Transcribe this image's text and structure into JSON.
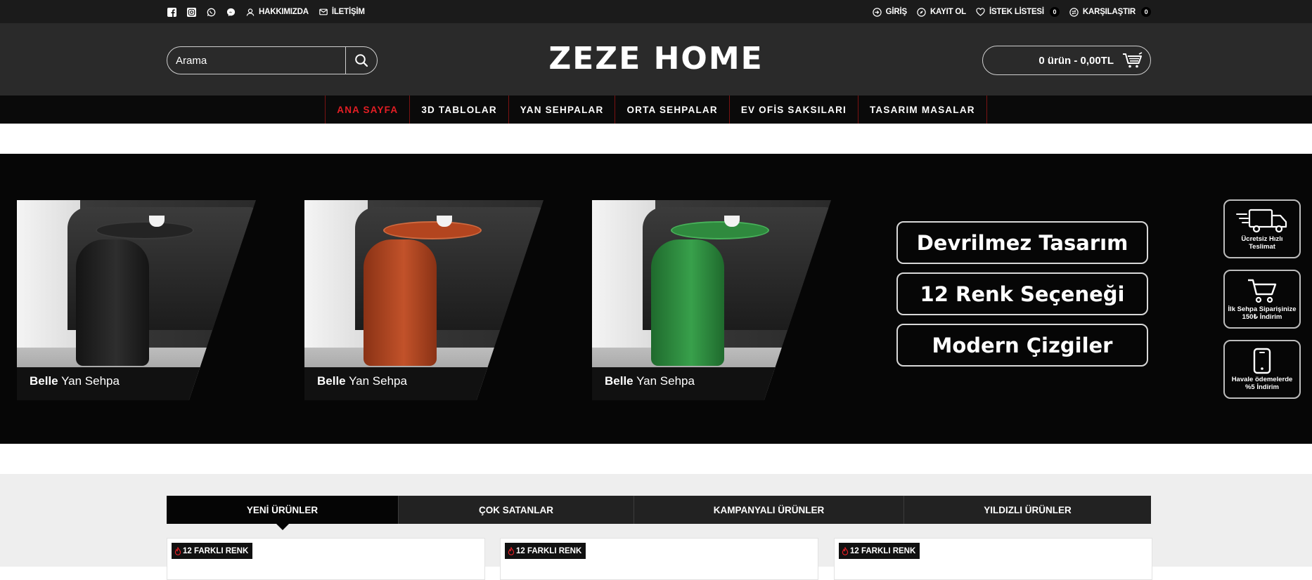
{
  "topbar": {
    "social_icons": [
      "facebook-icon",
      "instagram-icon",
      "whatsapp-icon",
      "messenger-icon"
    ],
    "about": "HAKKIMIZDA",
    "contact": "İLETİŞİM",
    "login": "GİRİŞ",
    "register": "KAYIT OL",
    "wishlist": "İSTEK LİSTESİ",
    "wishlist_count": "0",
    "compare": "KARŞILAŞTIR",
    "compare_count": "0"
  },
  "header": {
    "search_placeholder": "Arama",
    "logo": "ZEZE HOME",
    "cart_text": "0 ürün - 0,00TL"
  },
  "nav": {
    "items": [
      "ANA SAYFA",
      "3D TABLOLAR",
      "YAN SEHPALAR",
      "ORTA SEHPALAR",
      "EV OFİS SAKSILARI",
      "TASARIM MASALAR"
    ],
    "active_index": 0
  },
  "banner": {
    "products": [
      {
        "brand": "Belle",
        "name": "Yan Sehpa",
        "color": "#1e1e1e"
      },
      {
        "brand": "Belle",
        "name": "Yan Sehpa",
        "color": "#b3451f"
      },
      {
        "brand": "Belle",
        "name": "Yan Sehpa",
        "color": "#2f8a3e"
      }
    ],
    "features": [
      "Devrilmez Tasarım",
      "12 Renk Seçeneği",
      "Modern Çizgiler"
    ],
    "services": [
      {
        "icon": "truck-icon",
        "text": "Ücretsiz Hızlı Teslimat"
      },
      {
        "icon": "cart-icon",
        "text": "İlk Sehpa Siparişinize 150₺ İndirim"
      },
      {
        "icon": "phone-icon",
        "text": "Havale ödemelerde %5 İndirim"
      }
    ]
  },
  "tabs": {
    "items": [
      "YENİ ÜRÜNLER",
      "ÇOK SATANLAR",
      "KAMPANYALI ÜRÜNLER",
      "YILDIZLI ÜRÜNLER"
    ],
    "active_index": 0
  },
  "cards": {
    "badge": "12 FARKLI RENK"
  },
  "colors": {
    "accent": "#e31e24",
    "header_bg": "#2a2a2a",
    "nav_bg": "#0a0a0a"
  }
}
